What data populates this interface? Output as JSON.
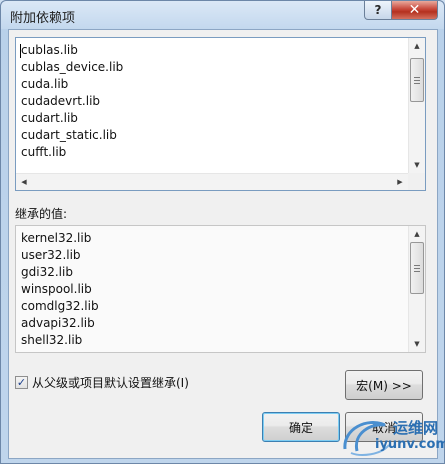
{
  "window": {
    "title": "附加依赖项",
    "help_label": "?",
    "close_label": "✕"
  },
  "editable_list": {
    "lines": [
      "cublas.lib",
      "cublas_device.lib",
      "cuda.lib",
      "cudadevrt.lib",
      "cudart.lib",
      "cudart_static.lib",
      "cufft.lib"
    ]
  },
  "inherited": {
    "label": "继承的值:",
    "lines": [
      "kernel32.lib",
      "user32.lib",
      "gdi32.lib",
      "winspool.lib",
      "comdlg32.lib",
      "advapi32.lib",
      "shell32.lib"
    ]
  },
  "inherit_checkbox": {
    "checked": true,
    "check_glyph": "✓",
    "label": "从父级或项目默认设置继承(I)"
  },
  "buttons": {
    "macro": "宏(M) >>",
    "ok": "确定",
    "cancel": "取消"
  },
  "watermark": {
    "name": "运维网",
    "site": "iyunv.com"
  },
  "colors": {
    "close_button": "#c8473a",
    "default_button_border": "#3c7fb1",
    "watermark": "#2b6fb2"
  }
}
